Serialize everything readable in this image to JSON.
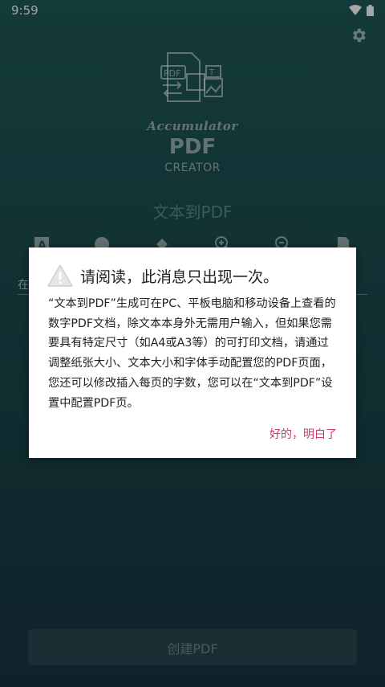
{
  "statusbar": {
    "time": "9:59"
  },
  "brand": {
    "script": "Accumulator",
    "pdf": "PDF",
    "creator": "CREATOR"
  },
  "page": {
    "title": "文本到PDF"
  },
  "editor": {
    "hint": "在"
  },
  "main": {
    "create_button": "创建PDF"
  },
  "icons": [
    "wifi-icon",
    "battery-icon",
    "gear-icon",
    "font-icon",
    "palette-icon",
    "fill-icon",
    "zoom-in-icon",
    "zoom-out-icon",
    "document-icon",
    "warning-icon"
  ],
  "dialog": {
    "title": "请阅读，此消息只出现一次。",
    "body": "“文本到PDF”生成可在PC、平板电脑和移动设备上查看的数字PDF文档，除文本本身外无需用户输入，但如果您需要具有特定尺寸（如A4或A3等）的可打印文档，请通过调整纸张大小、文本大小和字体手动配置您的PDF页面，您还可以修改插入每页的字数，您可以在“文本到PDF”设置中配置PDF页。",
    "ok_button": "好的，明白了",
    "accent": "#d6336c"
  }
}
